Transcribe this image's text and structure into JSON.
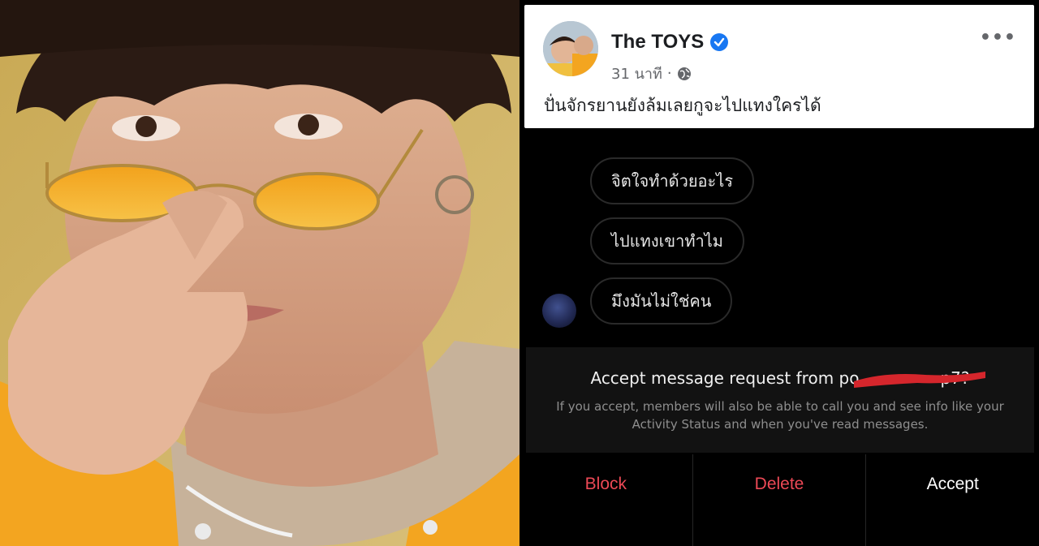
{
  "post": {
    "author": "The TOYS",
    "time": "31 นาที",
    "separator": "·",
    "text": "ปั่นจักรยานยังล้มเลยกูจะไปแทงใครได้",
    "verified_icon": "verified-badge-icon",
    "privacy_icon": "globe-icon",
    "more_icon": "more-options-icon"
  },
  "messages": [
    {
      "text": "จิตใจทำด้วยอะไร"
    },
    {
      "text": "ไปแทงเขาทำไม"
    },
    {
      "text": "มึงมันไม่ใช่คน"
    }
  ],
  "request": {
    "title_prefix": "Accept message request from ",
    "title_visible": "po",
    "title_suffix": "p7?",
    "body": "If you accept, members will also be able to call you and see info like your Activity Status and when you've read messages."
  },
  "actions": {
    "block": "Block",
    "delete": "Delete",
    "accept": "Accept"
  },
  "colors": {
    "danger": "#ed4956",
    "verified": "#1877f2",
    "background": "#000000"
  }
}
